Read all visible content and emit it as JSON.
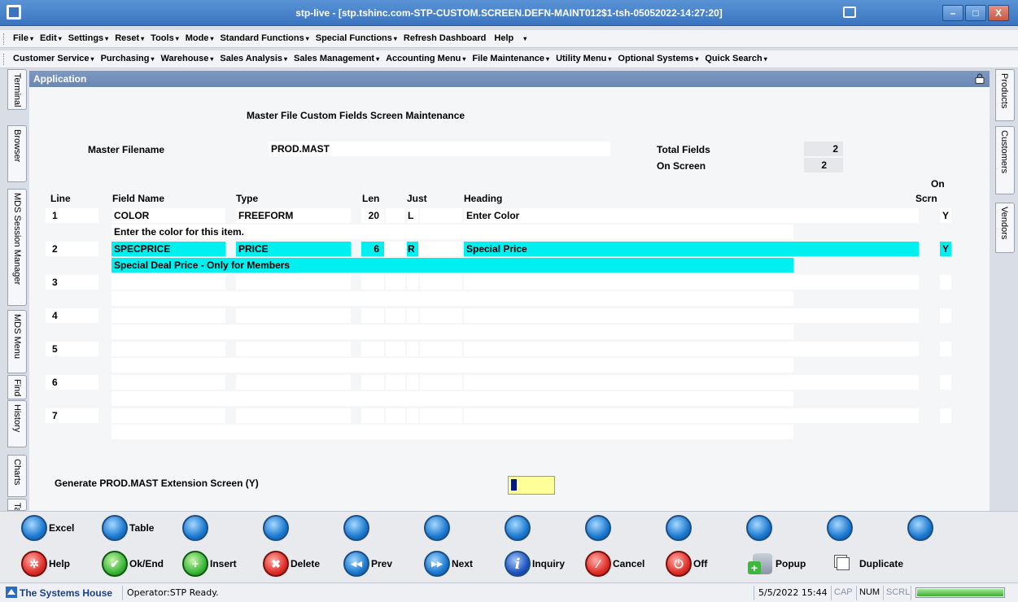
{
  "window": {
    "title": "stp-live - [stp.tshinc.com-STP-CUSTOM.SCREEN.DEFN-MAINT012$1-tsh-05052022-14:27:20]",
    "controls": [
      "–",
      "□",
      "X"
    ]
  },
  "menus": {
    "row1": [
      "File",
      "Edit",
      "Settings",
      "Reset",
      "Tools",
      "Mode",
      "Standard Functions",
      "Special Functions",
      "Refresh Dashboard",
      "Help"
    ],
    "row2": [
      "Customer Service",
      "Purchasing",
      "Warehouse",
      "Sales Analysis",
      "Sales Management",
      "Accounting Menu",
      "File Maintenance",
      "Utility Menu",
      "Optional Systems",
      "Quick Search"
    ]
  },
  "left_tabs": [
    "Terminal",
    "Browser",
    "MDS Session Manager",
    "MDS Menu",
    "Find",
    "History",
    "Charts",
    "Ta"
  ],
  "right_tabs": [
    "Products",
    "Customers",
    "Vendors"
  ],
  "panel": {
    "header": "Application",
    "screen_title": "Master File Custom Fields Screen Maintenance",
    "master_filename_label": "Master Filename",
    "master_filename_value": "PROD.MAST",
    "total_fields_label": "Total Fields",
    "total_fields_value": "2",
    "on_screen_label": "On Screen",
    "on_screen_value": "2",
    "columns": {
      "line": "Line",
      "field_name": "Field Name",
      "type": "Type",
      "len": "Len",
      "just": "Just",
      "heading": "Heading",
      "on_scrn_top": "On",
      "on_scrn_bottom": "Scrn"
    },
    "rows": [
      {
        "line": "1",
        "field_name": "COLOR",
        "type": "FREEFORM",
        "len": "20",
        "just": "L",
        "heading": "Enter Color",
        "on_scrn": "Y",
        "description": "Enter the color for this item."
      },
      {
        "line": "2",
        "field_name": "SPECPRICE",
        "type": "PRICE",
        "len": "6",
        "just": "R",
        "heading": "Special Price",
        "on_scrn": "Y",
        "description": "Special Deal Price - Only for Members"
      },
      {
        "line": "3",
        "field_name": "",
        "type": "",
        "len": "",
        "just": "",
        "heading": "",
        "on_scrn": "",
        "description": ""
      },
      {
        "line": "4",
        "field_name": "",
        "type": "",
        "len": "",
        "just": "",
        "heading": "",
        "on_scrn": "",
        "description": ""
      },
      {
        "line": "5",
        "field_name": "",
        "type": "",
        "len": "",
        "just": "",
        "heading": "",
        "on_scrn": "",
        "description": ""
      },
      {
        "line": "6",
        "field_name": "",
        "type": "",
        "len": "",
        "just": "",
        "heading": "",
        "on_scrn": "",
        "description": ""
      },
      {
        "line": "7",
        "field_name": "",
        "type": "",
        "len": "",
        "just": "",
        "heading": "",
        "on_scrn": "",
        "description": ""
      }
    ],
    "generate_label": "Generate PROD.MAST Extension Screen (Y)"
  },
  "toolbar": {
    "row1": [
      "Excel",
      "Table",
      "",
      "",
      "",
      "",
      "",
      "",
      "",
      "",
      "",
      ""
    ],
    "row2": [
      {
        "label": "Help",
        "icon": "help-icon"
      },
      {
        "label": "Ok/End",
        "icon": "check-icon"
      },
      {
        "label": "Insert",
        "icon": "plus-icon"
      },
      {
        "label": "Delete",
        "icon": "delete-icon"
      },
      {
        "label": "Prev",
        "icon": "prev-icon"
      },
      {
        "label": "Next",
        "icon": "next-icon"
      },
      {
        "label": "Inquiry",
        "icon": "info-icon"
      },
      {
        "label": "Cancel",
        "icon": "cancel-icon"
      },
      {
        "label": "Off",
        "icon": "power-icon"
      },
      {
        "label": "Popup",
        "icon": "popup-icon"
      },
      {
        "label": "Duplicate",
        "icon": "duplicate-icon"
      }
    ]
  },
  "status": {
    "company": "The Systems House",
    "operator": "Operator:STP Ready.",
    "datetime": "5/5/2022 15:44",
    "cap": "CAP",
    "num": "NUM",
    "scrl": "SCRL",
    "progress": 1.0
  },
  "colors": {
    "selected_row": "#00f0f0",
    "title_bar": "#3a74c0",
    "panel_header": "#6a86b2",
    "input_highlight": "#ffff99"
  }
}
